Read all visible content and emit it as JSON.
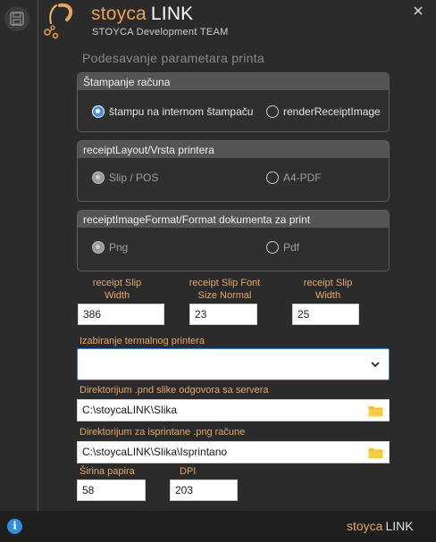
{
  "header": {
    "brand_name": "stoyca",
    "brand_link": "LINK",
    "team": "STOYCA Development TEAM"
  },
  "page_title": "Podesavanje parametara printa",
  "groups": {
    "stampanje": {
      "title": "Štampanje računa",
      "options": [
        "štampu na internom štampaču",
        "renderReceiptImage"
      ],
      "selected": "štampu na internom štampaču"
    },
    "layout": {
      "title": "receiptLayout/Vrsta printera",
      "options": [
        "Slip / POS",
        "A4-PDF"
      ],
      "selected": "Slip / POS"
    },
    "format": {
      "title": "receiptImageFormat/Format dokumenta za print",
      "options": [
        "Png",
        "Pdf"
      ],
      "selected": "Png"
    }
  },
  "fields": {
    "slip_width": {
      "label_line1": "receipt Slip",
      "label_line2": "Width",
      "value": "386"
    },
    "slip_font": {
      "label_line1": "receipt Slip Font",
      "label_line2": "Size Normal",
      "value": "23"
    },
    "slip_width2": {
      "label_line1": "receipt Slip",
      "label_line2": "Width",
      "value": "25"
    },
    "printer_select": {
      "label": "Izabiranje termalnog printera",
      "value": ""
    },
    "dir_png": {
      "label": "Direktorijum .pnd  slike odgovora sa servera",
      "value": "C:\\stoycaLINK\\Slika"
    },
    "dir_printed": {
      "label": "Direktorijum za isprintane .png račune",
      "value": "C:\\stoycaLINK\\Slika\\Isprintano"
    },
    "paper_width": {
      "label": "Širina papira",
      "value": "58"
    },
    "dpi": {
      "label": "DPI",
      "value": "203"
    }
  },
  "footer": {
    "brand_name": "stoyca",
    "brand_link": "LINK",
    "info_glyph": "i"
  },
  "colors": {
    "accent": "#e8a35a",
    "radio_selected": "#4a90e2",
    "folder": "#f2c230",
    "background": "#2b2b2b"
  }
}
